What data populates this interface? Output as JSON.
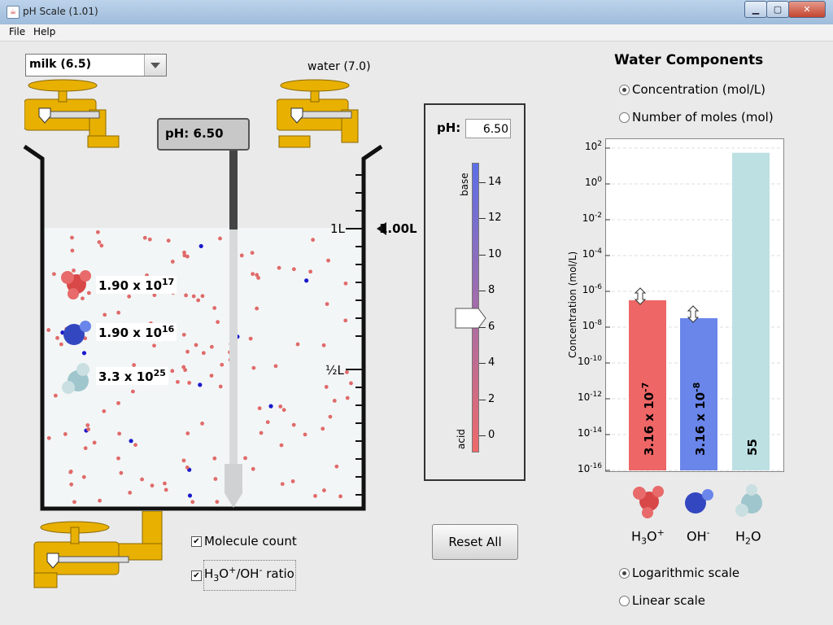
{
  "window": {
    "title": "pH Scale (1.01)"
  },
  "menu": {
    "items": [
      "File",
      "Help"
    ]
  },
  "solution": {
    "selected": "milk (6.5)",
    "water_faucet_label": "water (7.0)"
  },
  "probe": {
    "reading": "pH: 6.50"
  },
  "beaker": {
    "volume_label": "1.00L",
    "mark_1l": "1L",
    "mark_half": "½L"
  },
  "molecule_counts": {
    "h3o": {
      "mantissa": "1.90 x 10",
      "exponent": "17"
    },
    "oh": {
      "mantissa": "1.90 x 10",
      "exponent": "16"
    },
    "h2o": {
      "mantissa": "3.3 x 10",
      "exponent": "25"
    }
  },
  "slider": {
    "label": "pH:",
    "value": "6.50",
    "top_label": "base",
    "bottom_label": "acid",
    "ticks": [
      "14",
      "12",
      "10",
      "8",
      "6",
      "4",
      "2",
      "0"
    ],
    "ph_level": 6.5
  },
  "options": {
    "molecule_count_label": "Molecule count",
    "molecule_count_checked": true,
    "ratio_label_h3o": "H",
    "ratio_label_sub": "3",
    "ratio_label_o": "O",
    "ratio_label_plus": "+",
    "ratio_label_oh": "/OH",
    "ratio_label_minus": "-",
    "ratio_label_ratio": " ratio",
    "ratio_checked": true
  },
  "reset_button": "Reset All",
  "water_components": {
    "title": "Water Components",
    "radio_concentration": "Concentration (mol/L)",
    "radio_moles": "Number of moles (mol)",
    "radio_log": "Logarithmic scale",
    "radio_linear": "Linear scale",
    "selected_units": "concentration",
    "selected_scale": "log"
  },
  "chart_data": {
    "type": "bar",
    "ylabel": "Concentration (mol/L)",
    "scale": "log",
    "ylim_exponents": [
      -16,
      2
    ],
    "y_tick_exponents": [
      "2",
      "0",
      "-2",
      "-4",
      "-6",
      "-8",
      "-10",
      "-12",
      "-14",
      "-16"
    ],
    "categories": [
      "H3O+",
      "OH-",
      "H2O"
    ],
    "values": [
      3.16e-07,
      3.16e-08,
      55
    ],
    "value_labels": [
      {
        "mantissa": "3.16 x 10",
        "exponent": "-7"
      },
      {
        "mantissa": "3.16 x 10",
        "exponent": "-8"
      },
      {
        "mantissa": "55",
        "exponent": ""
      }
    ],
    "colors": [
      "#ee6666",
      "#6a86ea",
      "#bde0e3"
    ],
    "category_labels": [
      {
        "base": "H",
        "sub": "3",
        "tail": "O",
        "sup": "+"
      },
      {
        "base": "OH",
        "sub": "",
        "tail": "",
        "sup": "-"
      },
      {
        "base": "H",
        "sub": "2",
        "tail": "O",
        "sup": ""
      }
    ]
  }
}
